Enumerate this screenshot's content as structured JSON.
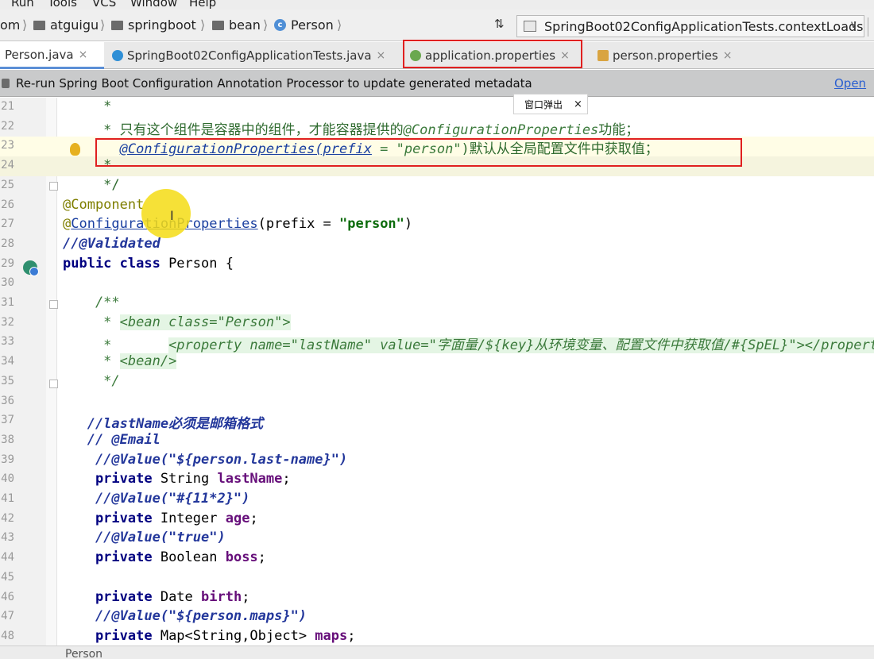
{
  "menu": [
    "Run",
    "Tools",
    "VCS",
    "Window",
    "Help"
  ],
  "breadcrumb": {
    "root": "om",
    "items": [
      "atguigu",
      "springboot",
      "bean",
      "Person"
    ]
  },
  "run_config": "SpringBoot02ConfigApplicationTests.contextLoads",
  "tabs": [
    {
      "label": "Person.java",
      "close": "×"
    },
    {
      "label": "SpringBoot02ConfigApplicationTests.java",
      "close": "×"
    },
    {
      "label": "application.properties",
      "close": "×"
    },
    {
      "label": "person.properties",
      "close": "×"
    }
  ],
  "notification": {
    "message": "Re-run Spring Boot Configuration Annotation Processor to update generated metadata",
    "link": "Open"
  },
  "tooltip": {
    "text": "窗口弹出",
    "close": "×"
  },
  "status": "Person",
  "colors": {
    "highlight_box": "#e02020",
    "active_tab_underline": "#5b8fd6"
  },
  "lines": [
    {
      "n": "21",
      "parts": [
        {
          "t": "     *",
          "c": "cmt"
        }
      ]
    },
    {
      "n": "22",
      "parts": [
        {
          "t": "     * 只有这个组件是容器中的组件，才能容器提供的",
          "c": "cmt"
        },
        {
          "t": "@ConfigurationProperties",
          "c": "doc"
        },
        {
          "t": "功能；",
          "c": "cmt"
        }
      ]
    },
    {
      "n": "23",
      "parts": [
        {
          "t": "       ",
          "c": ""
        },
        {
          "t": "@ConfigurationProperties(prefix",
          "c": "doc link"
        },
        {
          "t": " = ",
          "c": "doc"
        },
        {
          "t": "\"person\"",
          "c": "doc"
        },
        {
          "t": ")默认从全局配置文件中获取值；",
          "c": "cmt"
        }
      ]
    },
    {
      "n": "24",
      "parts": [
        {
          "t": "     *",
          "c": "cmt"
        }
      ]
    },
    {
      "n": "25",
      "parts": [
        {
          "t": "     */",
          "c": "cmt"
        }
      ]
    },
    {
      "n": "26",
      "parts": [
        {
          "t": "@Component",
          "c": "ann"
        }
      ]
    },
    {
      "n": "27",
      "parts": [
        {
          "t": "@",
          "c": "ann"
        },
        {
          "t": "ConfigurationProperties",
          "c": "link"
        },
        {
          "t": "(prefix = ",
          "c": ""
        },
        {
          "t": "\"person\"",
          "c": "strb"
        },
        {
          "t": ")",
          "c": ""
        }
      ]
    },
    {
      "n": "28",
      "parts": [
        {
          "t": "//@Validated",
          "c": "jc"
        }
      ]
    },
    {
      "n": "29",
      "parts": [
        {
          "t": "public class ",
          "c": "kw"
        },
        {
          "t": "Person {",
          "c": ""
        }
      ]
    },
    {
      "n": "30",
      "parts": [
        {
          "t": "",
          "c": ""
        }
      ]
    },
    {
      "n": "31",
      "parts": [
        {
          "t": "    /**",
          "c": "doc"
        }
      ]
    },
    {
      "n": "32",
      "parts": [
        {
          "t": "     * ",
          "c": "doc"
        },
        {
          "t": "<bean class=\"Person\">",
          "c": "doc doctag"
        }
      ]
    },
    {
      "n": "33",
      "parts": [
        {
          "t": "     *       ",
          "c": "doc"
        },
        {
          "t": "<property name=\"lastName\" value=\"字面量/${key}从环境变量、配置文件中获取值/#{SpEL}\"></property>",
          "c": "doc doctag"
        }
      ]
    },
    {
      "n": "34",
      "parts": [
        {
          "t": "     * ",
          "c": "doc"
        },
        {
          "t": "<bean/>",
          "c": "doc doctag"
        }
      ]
    },
    {
      "n": "35",
      "parts": [
        {
          "t": "     */",
          "c": "doc"
        }
      ]
    },
    {
      "n": "36",
      "parts": [
        {
          "t": "",
          "c": ""
        }
      ]
    },
    {
      "n": "37",
      "parts": [
        {
          "t": "   //lastName必须是邮箱格式",
          "c": "jc"
        }
      ]
    },
    {
      "n": "38",
      "parts": [
        {
          "t": "   // @Email",
          "c": "jc"
        }
      ]
    },
    {
      "n": "39",
      "parts": [
        {
          "t": "    //@Value(\"${person.last-name}\")",
          "c": "jc"
        }
      ]
    },
    {
      "n": "40",
      "parts": [
        {
          "t": "    private ",
          "c": "kw"
        },
        {
          "t": "String ",
          "c": ""
        },
        {
          "t": "lastName",
          "c": "field"
        },
        {
          "t": ";",
          "c": ""
        }
      ]
    },
    {
      "n": "41",
      "parts": [
        {
          "t": "    //@Value(\"#{11*2}\")",
          "c": "jc"
        }
      ]
    },
    {
      "n": "42",
      "parts": [
        {
          "t": "    private ",
          "c": "kw"
        },
        {
          "t": "Integer ",
          "c": ""
        },
        {
          "t": "age",
          "c": "field"
        },
        {
          "t": ";",
          "c": ""
        }
      ]
    },
    {
      "n": "43",
      "parts": [
        {
          "t": "    //@Value(\"true\")",
          "c": "jc"
        }
      ]
    },
    {
      "n": "44",
      "parts": [
        {
          "t": "    private ",
          "c": "kw"
        },
        {
          "t": "Boolean ",
          "c": ""
        },
        {
          "t": "boss",
          "c": "field"
        },
        {
          "t": ";",
          "c": ""
        }
      ]
    },
    {
      "n": "45",
      "parts": [
        {
          "t": "",
          "c": ""
        }
      ]
    },
    {
      "n": "46",
      "parts": [
        {
          "t": "    private ",
          "c": "kw"
        },
        {
          "t": "Date ",
          "c": ""
        },
        {
          "t": "birth",
          "c": "field"
        },
        {
          "t": ";",
          "c": ""
        }
      ]
    },
    {
      "n": "47",
      "parts": [
        {
          "t": "    //@Value(\"${person.maps}\")",
          "c": "jc"
        }
      ]
    },
    {
      "n": "48",
      "parts": [
        {
          "t": "    private ",
          "c": "kw"
        },
        {
          "t": "Map<String,Object> ",
          "c": ""
        },
        {
          "t": "maps",
          "c": "field"
        },
        {
          "t": ";",
          "c": ""
        }
      ]
    }
  ]
}
